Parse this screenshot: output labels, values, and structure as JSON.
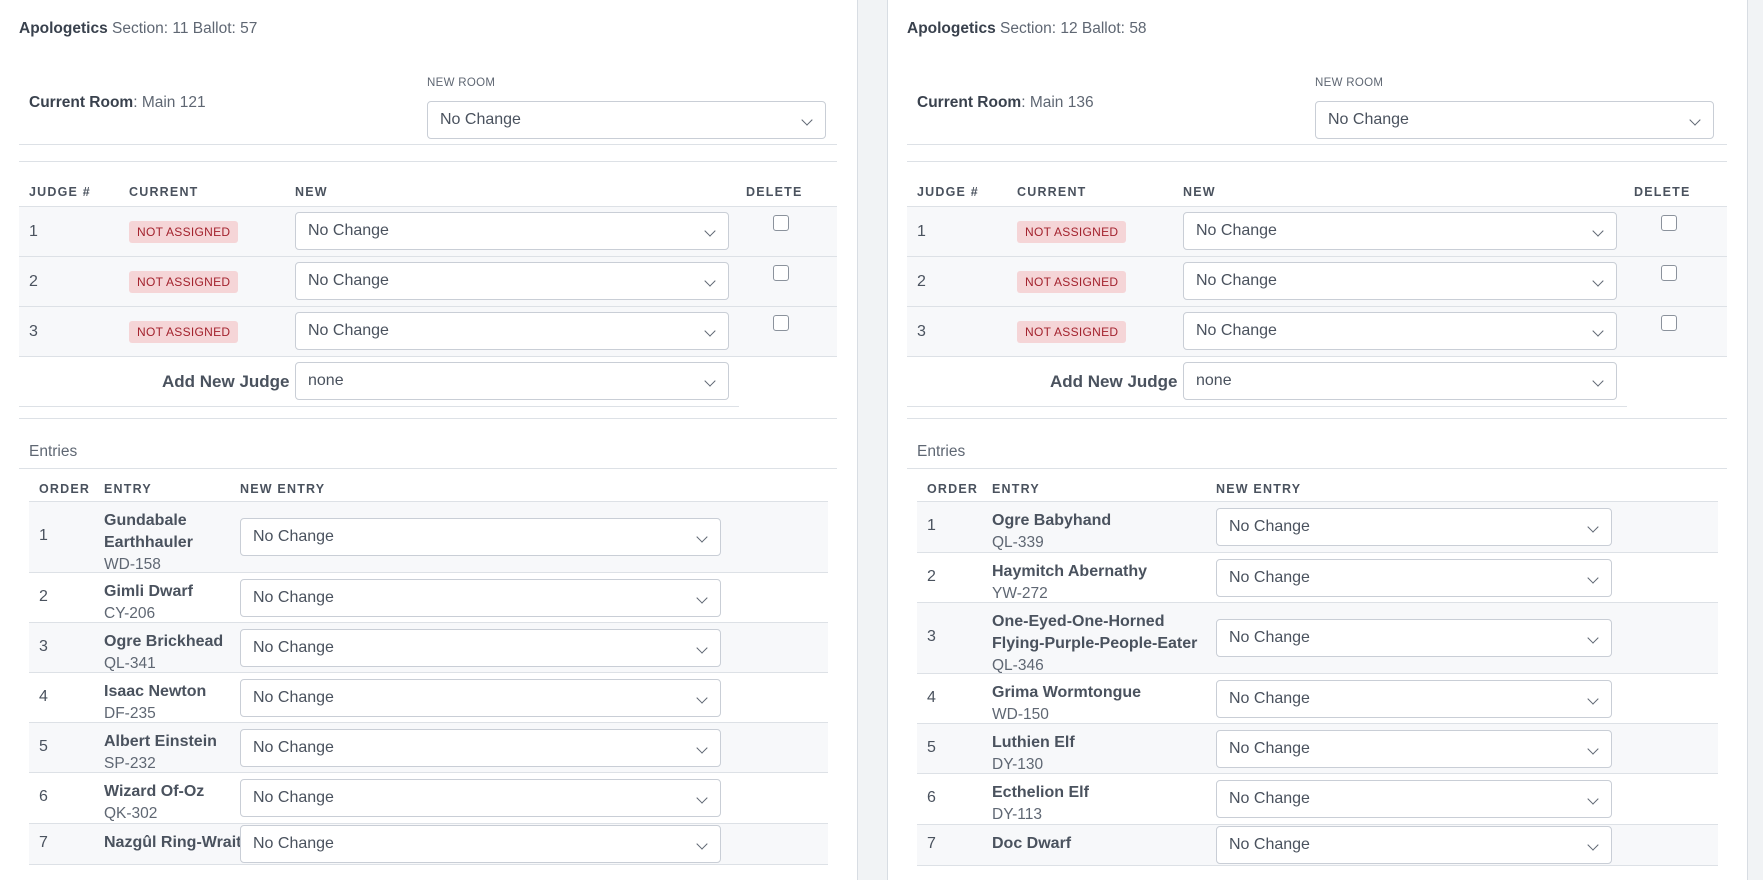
{
  "labels": {
    "section_prefix": "Section:",
    "ballot_prefix": "Ballot:",
    "current_room": "Current Room",
    "new_room": "NEW ROOM",
    "judge_col": "JUDGE #",
    "current_col": "CURRENT",
    "new_col": "NEW",
    "delete_col": "DELETE",
    "add_new_judge": "Add New Judge",
    "entries": "Entries",
    "order_col": "ORDER",
    "entry_col": "ENTRY",
    "new_entry_col": "NEW ENTRY",
    "no_change": "No Change",
    "none": "none",
    "not_assigned": "NOT ASSIGNED"
  },
  "colors": {
    "badge_bg": "#f5d5d7",
    "badge_text": "#a3222d",
    "row_shade": "#f7f8fa"
  },
  "icons": {
    "select": "chevron-down-icon",
    "delete": "checkbox"
  },
  "panels": [
    {
      "event": "Apologetics",
      "section": "11",
      "ballot": "57",
      "current_room": "Main 121",
      "new_room": "No Change",
      "judges": [
        {
          "num": "1",
          "current": "NOT ASSIGNED",
          "new": "No Change",
          "delete": false
        },
        {
          "num": "2",
          "current": "NOT ASSIGNED",
          "new": "No Change",
          "delete": false
        },
        {
          "num": "3",
          "current": "NOT ASSIGNED",
          "new": "No Change",
          "delete": false
        }
      ],
      "add_judge_value": "none",
      "entries": [
        {
          "order": "1",
          "name": "Gundabale Earthhauler",
          "code": "WD-158",
          "new": "No Change"
        },
        {
          "order": "2",
          "name": "Gimli Dwarf",
          "code": "CY-206",
          "new": "No Change"
        },
        {
          "order": "3",
          "name": "Ogre Brickhead",
          "code": "QL-341",
          "new": "No Change"
        },
        {
          "order": "4",
          "name": "Isaac Newton",
          "code": "DF-235",
          "new": "No Change"
        },
        {
          "order": "5",
          "name": "Albert Einstein",
          "code": "SP-232",
          "new": "No Change"
        },
        {
          "order": "6",
          "name": "Wizard Of-Oz",
          "code": "QK-302",
          "new": "No Change"
        },
        {
          "order": "7",
          "name": "Nazgûl Ring-Wraith",
          "code": "",
          "new": "No Change"
        }
      ]
    },
    {
      "event": "Apologetics",
      "section": "12",
      "ballot": "58",
      "current_room": "Main 136",
      "new_room": "No Change",
      "judges": [
        {
          "num": "1",
          "current": "NOT ASSIGNED",
          "new": "No Change",
          "delete": false
        },
        {
          "num": "2",
          "current": "NOT ASSIGNED",
          "new": "No Change",
          "delete": false
        },
        {
          "num": "3",
          "current": "NOT ASSIGNED",
          "new": "No Change",
          "delete": false
        }
      ],
      "add_judge_value": "none",
      "entries": [
        {
          "order": "1",
          "name": "Ogre Babyhand",
          "code": "QL-339",
          "new": "No Change"
        },
        {
          "order": "2",
          "name": "Haymitch Abernathy",
          "code": "YW-272",
          "new": "No Change"
        },
        {
          "order": "3",
          "name": "One-Eyed-One-Horned Flying-Purple-People-Eater",
          "code": "QL-346",
          "new": "No Change"
        },
        {
          "order": "4",
          "name": "Grima Wormtongue",
          "code": "WD-150",
          "new": "No Change"
        },
        {
          "order": "5",
          "name": "Luthien Elf",
          "code": "DY-130",
          "new": "No Change"
        },
        {
          "order": "6",
          "name": "Ecthelion Elf",
          "code": "DY-113",
          "new": "No Change"
        },
        {
          "order": "7",
          "name": "Doc Dwarf",
          "code": "",
          "new": "No Change"
        }
      ]
    }
  ]
}
